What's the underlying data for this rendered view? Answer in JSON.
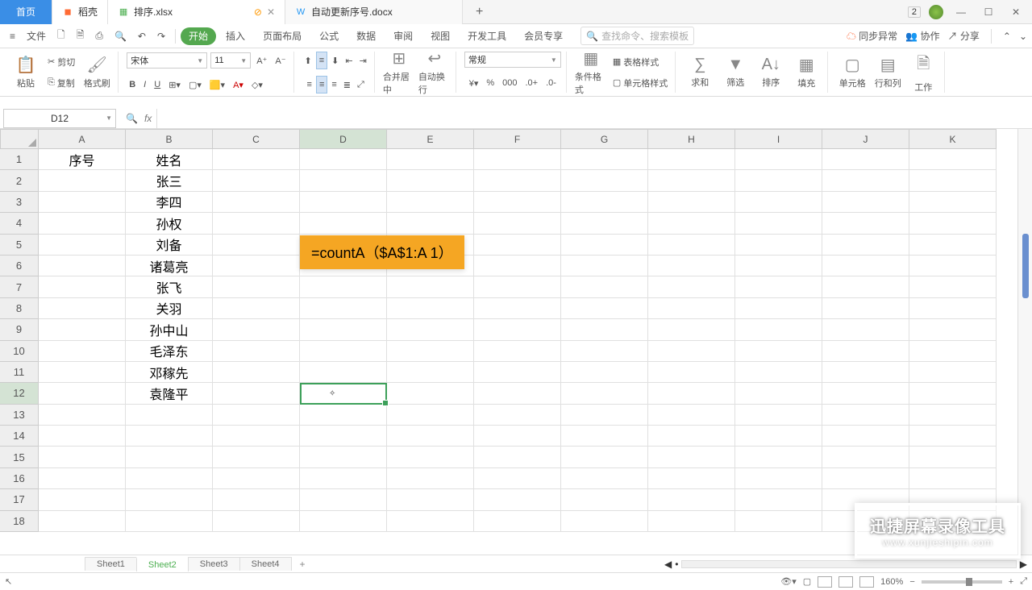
{
  "tabs": {
    "home": "首页",
    "doc_hub": "稻壳",
    "file1": "排序.xlsx",
    "file2": "自动更新序号.docx"
  },
  "badge_number": "2",
  "menu": {
    "file": "文件",
    "tabs": [
      "开始",
      "插入",
      "页面布局",
      "公式",
      "数据",
      "审阅",
      "视图",
      "开发工具",
      "会员专享"
    ],
    "search_placeholder": "查找命令、搜索模板",
    "sync": "同步异常",
    "coop": "协作",
    "share": "分享"
  },
  "ribbon": {
    "paste": "粘贴",
    "cut": "剪切",
    "copy": "复制",
    "format_painter": "格式刷",
    "font_name": "宋体",
    "font_size": "11",
    "merge_center": "合并居中",
    "auto_wrap": "自动换行",
    "number_format": "常规",
    "cond_format": "条件格式",
    "table_style": "表格样式",
    "cell_style": "单元格样式",
    "sum": "求和",
    "filter": "筛选",
    "sort": "排序",
    "fill": "填充",
    "cell": "单元格",
    "row_col": "行和列",
    "worksheet": "工作"
  },
  "name_box": "D12",
  "fx": "fx",
  "columns": [
    "A",
    "B",
    "C",
    "D",
    "E",
    "F",
    "G",
    "H",
    "I",
    "J",
    "K"
  ],
  "rows": [
    "1",
    "2",
    "3",
    "4",
    "5",
    "6",
    "7",
    "8",
    "9",
    "10",
    "11",
    "12",
    "13",
    "14",
    "15",
    "16",
    "17",
    "18"
  ],
  "cells": {
    "A1": "序号",
    "B1": "姓名",
    "B2": "张三",
    "B3": "李四",
    "B4": "孙权",
    "B5": "刘备",
    "B6": "诸葛亮",
    "B7": "张飞",
    "B8": "关羽",
    "B9": "孙中山",
    "B10": "毛泽东",
    "B11": "邓稼先",
    "B12": "袁隆平"
  },
  "formula_tip": "=countA（$A$1:A 1）",
  "active_cell": {
    "col": "D",
    "row": "12"
  },
  "sheets": [
    "Sheet1",
    "Sheet2",
    "Sheet3",
    "Sheet4"
  ],
  "active_sheet": "Sheet2",
  "zoom": "160%",
  "watermark": {
    "line1": "迅捷屏幕录像工具",
    "line2": "www.xunjieshipin.com"
  }
}
